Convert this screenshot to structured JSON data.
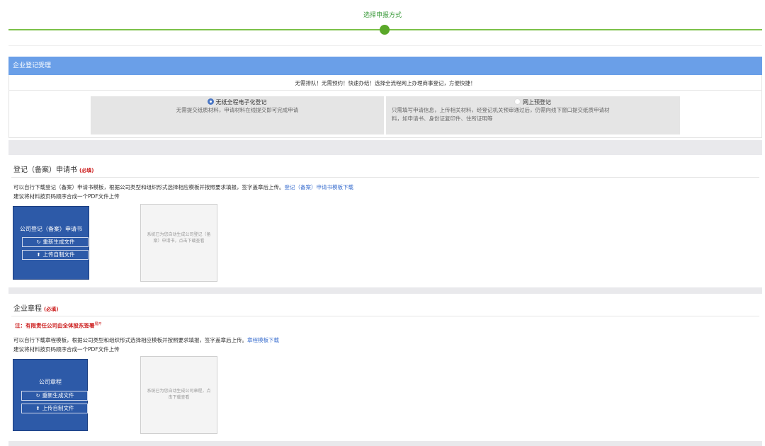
{
  "progress": {
    "step_title": "选择申报方式"
  },
  "acceptance": {
    "header": "企业登记受理",
    "notice": "无需排队！无需预约！快速办结！选择全流程网上办理商事登记，方便快捷！",
    "options": [
      {
        "title": "无纸全程电子化登记",
        "desc": "无需提交纸质材料，申请材料在线提交即可完成申请",
        "selected": true
      },
      {
        "title": "网上预登记",
        "desc_line1": "只需填写申请信息，上传相关材料，经登记机关预审通过后，仍需向线下窗口提交纸质申请材",
        "desc_line2": "料，如申请书、身份证复印件、住所证明等",
        "selected": false
      }
    ]
  },
  "sections": [
    {
      "title": "登记（备案）申请书",
      "required": "(必填)",
      "desc": "可以自行下载登记（备案）申请书模板，根据公司类型和组织形式选择相应模板并按照要求填报，签字盖章后上传。",
      "link": "登记（备案）申请书模板下载",
      "hint": "建议将材料按页码顺序合成一个PDF文件上传",
      "card_title": "公司登记（备案）申请书",
      "regen_btn": "重新生成文件",
      "upload_btn": "上传自制文件",
      "preview_text": "系统已为您自动生成公司登记（备案）申请书，点击下载查看"
    },
    {
      "title": "企业章程",
      "required": "(必填)",
      "note": "注：有限责任公司由全体股东签署",
      "note_sup": "展开",
      "desc": "可以自行下载章程模板，根据公司类型和组织形式选择相应模板并按照要求填报，签字盖章后上传。",
      "link": "章程模板下载",
      "hint": "建议将材料按页码顺序合成一个PDF文件上传",
      "card_title": "公司章程",
      "regen_btn": "重新生成文件",
      "upload_btn": "上传自制文件",
      "preview_text": "系统已为您自动生成公司章程，点击下载查看"
    }
  ],
  "colors": {
    "accent_green": "#5aa829",
    "header_blue": "#6a9fe8",
    "card_blue": "#2d5aa8",
    "required_red": "#cc1d1d",
    "link_blue": "#3b6fcf"
  },
  "icons": {
    "regen": "refresh-icon",
    "upload": "upload-icon"
  }
}
